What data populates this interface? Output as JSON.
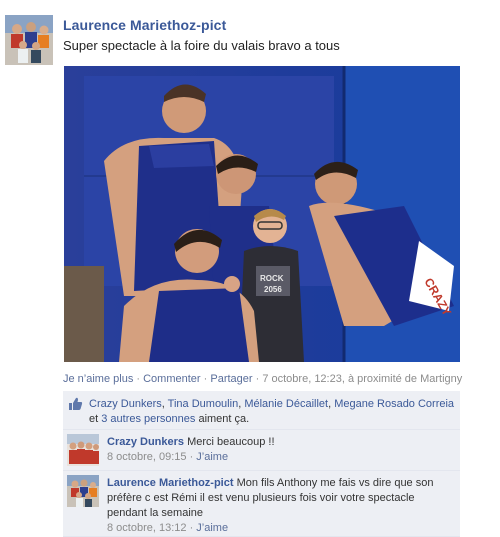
{
  "post": {
    "author": "Laurence Mariethoz-pict",
    "text": "Super spectacle à la foire du valais bravo a tous",
    "photo_alt": "Photo"
  },
  "actions": {
    "unlike": "Je n’aime plus",
    "sep1": " · ",
    "comment": "Commenter",
    "sep2": " · ",
    "share": "Partager",
    "meta": " · 7 octobre, 12:23, à proximité de Martigny"
  },
  "likes": {
    "names": [
      "Crazy Dunkers",
      "Tina Dumoulin",
      "Mélanie Décaillet",
      "Megane Rosado Correia"
    ],
    "sep": ", ",
    "and": " et ",
    "others": "3 autres personnes",
    "suffix": " aiment ça."
  },
  "comments": [
    {
      "author": "Crazy Dunkers",
      "text": " Merci beaucoup !!",
      "time": "8 octobre, 09:15",
      "sep": " · ",
      "like": "J’aime"
    },
    {
      "author": "Laurence Mariethoz-pict",
      "text": " Mon fils Anthony me fais vs dire que son préfère c est Rémi il est venu plusieurs fois voir votre spectacle pendant la semaine",
      "time": "8 octobre, 13:12",
      "sep": " · ",
      "like": "J’aime"
    }
  ],
  "colors": {
    "link": "#3b5998",
    "panel": "#edeff4",
    "meta": "#8c8c8c",
    "mat_blue": "#1b2f82"
  },
  "icons": {
    "like": "thumbs-up-icon"
  }
}
